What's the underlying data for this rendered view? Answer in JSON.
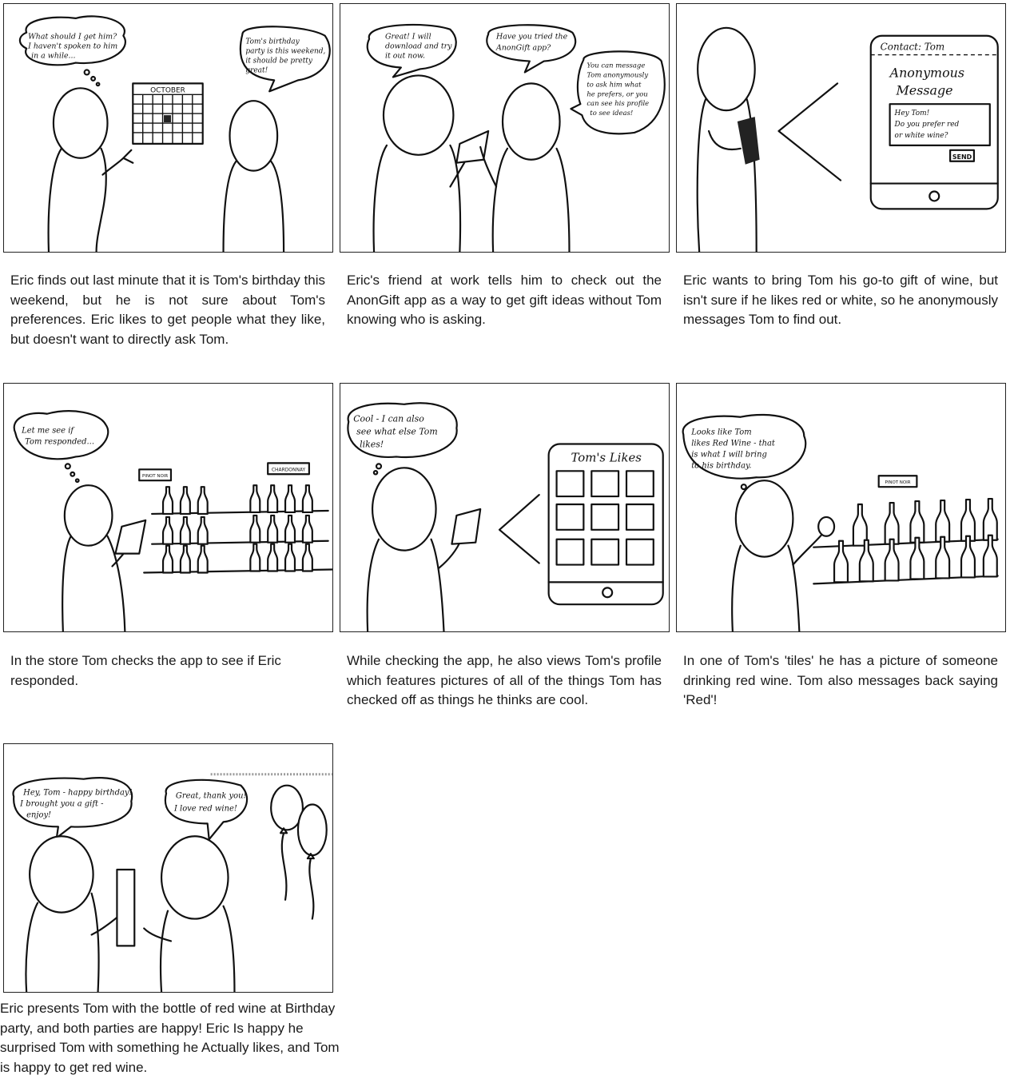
{
  "panels": [
    {
      "bubbles": [
        "What should I get him?",
        "I haven't spoken to him",
        "in a while...",
        "Tom's birthday",
        "party is this weekend,",
        "it should be pretty",
        "great!"
      ],
      "labels": [
        "OCTOBER"
      ],
      "caption": "Eric finds out last minute that it is Tom's birthday this weekend, but he is not sure about Tom's preferences.  Eric likes to get people what they like, but doesn't want to directly ask Tom."
    },
    {
      "bubbles": [
        "Great! I will",
        "download and try",
        "it out now.",
        "Have you tried the",
        "AnonGift app?",
        "You can message",
        "Tom anonymously",
        "to ask him what",
        "he prefers, or you",
        "can see his profile",
        "to see ideas!"
      ],
      "labels": [],
      "caption": "Eric's friend at work tells him to check out the AnonGift app as a way to get gift ideas without Tom knowing who is asking."
    },
    {
      "bubbles": [],
      "labels": [
        "Contact: Tom",
        "Anonymous",
        "Message",
        "Hey Tom!",
        "Do you prefer red",
        "or white wine?",
        "SEND"
      ],
      "caption": "Eric wants to bring Tom his go-to gift of wine, but isn't sure if he likes red or white, so he anonymously messages Tom to find out."
    },
    {
      "bubbles": [
        "Let me see if",
        "Tom responded..."
      ],
      "labels": [
        "PINOT NOIR",
        "CHARDONNAY"
      ],
      "caption": "In the store Tom checks the app to see if Eric responded."
    },
    {
      "bubbles": [
        "Cool - I can also",
        "see what else Tom",
        "likes!"
      ],
      "labels": [
        "Tom's Likes"
      ],
      "caption": "While checking the app, he also views Tom's profile which features pictures of all of the things Tom has checked off as things he thinks are cool."
    },
    {
      "bubbles": [
        "Looks like Tom",
        "likes Red Wine - that",
        "is what I will bring",
        "to his birthday."
      ],
      "labels": [
        "PINOT NOIR"
      ],
      "caption": "In one of Tom's 'tiles' he has a picture of someone drinking red wine.   Tom also messages back saying 'Red'!"
    },
    {
      "bubbles": [
        "Hey, Tom - happy birthday!",
        "I brought you a gift -",
        "enjoy!",
        "Great, thank you!",
        "I love red wine!"
      ],
      "labels": [],
      "caption": "Eric presents Tom with the bottle of red wine at Birthday party, and both parties are happy!  Eric Is happy he surprised Tom with something he Actually likes, and Tom is happy to get red wine."
    }
  ]
}
